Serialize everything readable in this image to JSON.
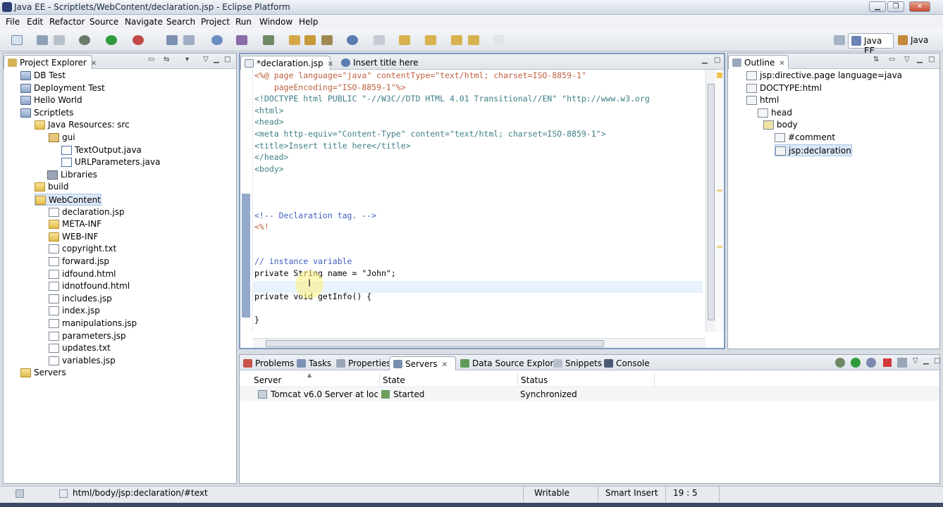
{
  "window": {
    "title": "Java EE - Scriptlets/WebContent/declaration.jsp - Eclipse Platform"
  },
  "menu": [
    "File",
    "Edit",
    "Refactor",
    "Source",
    "Navigate",
    "Search",
    "Project",
    "Run",
    "Window",
    "Help"
  ],
  "perspectives": {
    "java_ee": "Java EE",
    "java": "Java"
  },
  "project_explorer": {
    "title": "Project Explorer",
    "items": [
      {
        "label": "DB Test",
        "icon": "project-icon"
      },
      {
        "label": "Deployment Test",
        "icon": "project-icon"
      },
      {
        "label": "Hello World",
        "icon": "project-icon"
      },
      {
        "label": "Scriptlets",
        "icon": "project-icon"
      },
      {
        "label": "Java Resources: src",
        "icon": "java-resources-icon"
      },
      {
        "label": "gui",
        "icon": "package-icon"
      },
      {
        "label": "TextOutput.java",
        "icon": "java-file-icon"
      },
      {
        "label": "URLParameters.java",
        "icon": "java-file-icon"
      },
      {
        "label": "Libraries",
        "icon": "library-icon"
      },
      {
        "label": "build",
        "icon": "folder-icon"
      },
      {
        "label": "WebContent",
        "icon": "folder-icon"
      },
      {
        "label": "declaration.jsp",
        "icon": "file-icon"
      },
      {
        "label": "META-INF",
        "icon": "folder-icon"
      },
      {
        "label": "WEB-INF",
        "icon": "folder-icon"
      },
      {
        "label": "copyright.txt",
        "icon": "file-icon"
      },
      {
        "label": "forward.jsp",
        "icon": "file-icon"
      },
      {
        "label": "idfound.html",
        "icon": "file-icon"
      },
      {
        "label": "idnotfound.html",
        "icon": "file-icon"
      },
      {
        "label": "includes.jsp",
        "icon": "file-icon"
      },
      {
        "label": "index.jsp",
        "icon": "file-icon"
      },
      {
        "label": "manipulations.jsp",
        "icon": "file-icon"
      },
      {
        "label": "parameters.jsp",
        "icon": "file-icon"
      },
      {
        "label": "updates.txt",
        "icon": "file-icon"
      },
      {
        "label": "variables.jsp",
        "icon": "file-icon"
      },
      {
        "label": "Servers",
        "icon": "folder-icon"
      }
    ]
  },
  "editor": {
    "tabs": [
      {
        "label": "*declaration.jsp"
      },
      {
        "label": "Insert title here"
      }
    ],
    "lines": [
      "<%@ page language=\"java\" contentType=\"text/html; charset=ISO-8859-1\"",
      "    pageEncoding=\"ISO-8859-1\"%>",
      "<!DOCTYPE html PUBLIC \"-//W3C//DTD HTML 4.01 Transitional//EN\" \"http://www.w3.org",
      "<html>",
      "<head>",
      "<meta http-equiv=\"Content-Type\" content=\"text/html; charset=ISO-8859-1\">",
      "<title>Insert title here</title>",
      "</head>",
      "<body>",
      "",
      "",
      "<!-- Declaration tag. -->",
      "<%!",
      "",
      "// instance variable",
      "private String name = \"John\";",
      "",
      "private void getInfo() {",
      "",
      "}",
      "",
      "%>"
    ]
  },
  "outline": {
    "title": "Outline",
    "items": [
      {
        "label": "jsp:directive.page language=java"
      },
      {
        "label": "DOCTYPE:html"
      },
      {
        "label": "html"
      },
      {
        "label": "head"
      },
      {
        "label": "body"
      },
      {
        "label": "#comment"
      },
      {
        "label": "jsp:declaration"
      }
    ]
  },
  "bottom_panel": {
    "tabs": [
      "Problems",
      "Tasks",
      "Properties",
      "Servers",
      "Data Source Explorer",
      "Snippets",
      "Console"
    ],
    "columns": [
      "Server",
      "State",
      "Status"
    ],
    "rows": [
      {
        "server": "Tomcat v6.0 Server at localhos",
        "state": "Started",
        "status": "Synchronized"
      }
    ]
  },
  "status_bar": {
    "path": "html/body/jsp:declaration/#text",
    "writable": "Writable",
    "insert_mode": "Smart Insert",
    "position": "19 : 5"
  }
}
